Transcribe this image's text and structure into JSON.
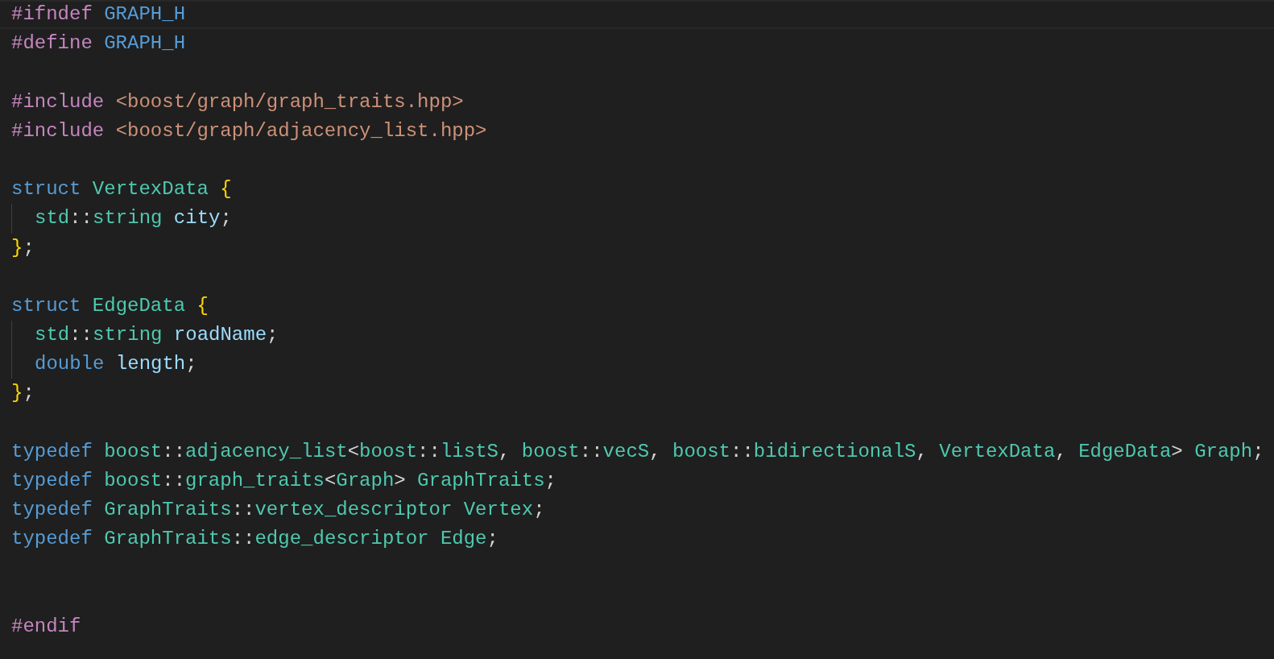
{
  "editor": {
    "lines": [
      {
        "kind": "code",
        "current": true,
        "tokens": [
          {
            "kind": "pp",
            "text": "#ifndef "
          },
          {
            "kind": "macro",
            "text": "GRAPH_H"
          }
        ]
      },
      {
        "kind": "code",
        "tokens": [
          {
            "kind": "pp",
            "text": "#define "
          },
          {
            "kind": "macro",
            "text": "GRAPH_H"
          }
        ]
      },
      {
        "kind": "blank"
      },
      {
        "kind": "code",
        "tokens": [
          {
            "kind": "pp",
            "text": "#include "
          },
          {
            "kind": "str",
            "text": "<boost/graph/graph_traits.hpp>"
          }
        ]
      },
      {
        "kind": "code",
        "tokens": [
          {
            "kind": "pp",
            "text": "#include "
          },
          {
            "kind": "str",
            "text": "<boost/graph/adjacency_list.hpp>"
          }
        ]
      },
      {
        "kind": "blank"
      },
      {
        "kind": "code",
        "tokens": [
          {
            "kind": "kw",
            "text": "struct "
          },
          {
            "kind": "type",
            "text": "VertexData "
          },
          {
            "kind": "brace",
            "text": "{"
          }
        ]
      },
      {
        "kind": "code",
        "indent_guide": true,
        "tokens": [
          {
            "kind": "type",
            "text": "std"
          },
          {
            "kind": "punct",
            "text": "::"
          },
          {
            "kind": "type",
            "text": "string "
          },
          {
            "kind": "var",
            "text": "city"
          },
          {
            "kind": "punct",
            "text": ";"
          }
        ]
      },
      {
        "kind": "code",
        "tokens": [
          {
            "kind": "brace",
            "text": "}"
          },
          {
            "kind": "punct",
            "text": ";"
          }
        ]
      },
      {
        "kind": "blank"
      },
      {
        "kind": "code",
        "tokens": [
          {
            "kind": "kw",
            "text": "struct "
          },
          {
            "kind": "type",
            "text": "EdgeData "
          },
          {
            "kind": "brace",
            "text": "{"
          }
        ]
      },
      {
        "kind": "code",
        "indent_guide": true,
        "tokens": [
          {
            "kind": "type",
            "text": "std"
          },
          {
            "kind": "punct",
            "text": "::"
          },
          {
            "kind": "type",
            "text": "string "
          },
          {
            "kind": "var",
            "text": "roadName"
          },
          {
            "kind": "punct",
            "text": ";"
          }
        ]
      },
      {
        "kind": "code",
        "indent_guide": true,
        "tokens": [
          {
            "kind": "kw",
            "text": "double "
          },
          {
            "kind": "var",
            "text": "length"
          },
          {
            "kind": "punct",
            "text": ";"
          }
        ]
      },
      {
        "kind": "code",
        "tokens": [
          {
            "kind": "brace",
            "text": "}"
          },
          {
            "kind": "punct",
            "text": ";"
          }
        ]
      },
      {
        "kind": "blank"
      },
      {
        "kind": "code",
        "tokens": [
          {
            "kind": "kw",
            "text": "typedef "
          },
          {
            "kind": "type",
            "text": "boost"
          },
          {
            "kind": "punct",
            "text": "::"
          },
          {
            "kind": "type",
            "text": "adjacency_list"
          },
          {
            "kind": "punct",
            "text": "<"
          },
          {
            "kind": "type",
            "text": "boost"
          },
          {
            "kind": "punct",
            "text": "::"
          },
          {
            "kind": "type",
            "text": "listS"
          },
          {
            "kind": "punct",
            "text": ", "
          },
          {
            "kind": "type",
            "text": "boost"
          },
          {
            "kind": "punct",
            "text": "::"
          },
          {
            "kind": "type",
            "text": "vecS"
          },
          {
            "kind": "punct",
            "text": ", "
          },
          {
            "kind": "type",
            "text": "boost"
          },
          {
            "kind": "punct",
            "text": "::"
          },
          {
            "kind": "type",
            "text": "bidirectionalS"
          },
          {
            "kind": "punct",
            "text": ", "
          },
          {
            "kind": "type",
            "text": "VertexData"
          },
          {
            "kind": "punct",
            "text": ", "
          },
          {
            "kind": "type",
            "text": "EdgeData"
          },
          {
            "kind": "punct",
            "text": "> "
          },
          {
            "kind": "type",
            "text": "Graph"
          },
          {
            "kind": "punct",
            "text": ";"
          }
        ]
      },
      {
        "kind": "code",
        "tokens": [
          {
            "kind": "kw",
            "text": "typedef "
          },
          {
            "kind": "type",
            "text": "boost"
          },
          {
            "kind": "punct",
            "text": "::"
          },
          {
            "kind": "type",
            "text": "graph_traits"
          },
          {
            "kind": "punct",
            "text": "<"
          },
          {
            "kind": "type",
            "text": "Graph"
          },
          {
            "kind": "punct",
            "text": "> "
          },
          {
            "kind": "type",
            "text": "GraphTraits"
          },
          {
            "kind": "punct",
            "text": ";"
          }
        ]
      },
      {
        "kind": "code",
        "tokens": [
          {
            "kind": "kw",
            "text": "typedef "
          },
          {
            "kind": "type",
            "text": "GraphTraits"
          },
          {
            "kind": "punct",
            "text": "::"
          },
          {
            "kind": "type",
            "text": "vertex_descriptor "
          },
          {
            "kind": "type",
            "text": "Vertex"
          },
          {
            "kind": "punct",
            "text": ";"
          }
        ]
      },
      {
        "kind": "code",
        "tokens": [
          {
            "kind": "kw",
            "text": "typedef "
          },
          {
            "kind": "type",
            "text": "GraphTraits"
          },
          {
            "kind": "punct",
            "text": "::"
          },
          {
            "kind": "type",
            "text": "edge_descriptor "
          },
          {
            "kind": "type",
            "text": "Edge"
          },
          {
            "kind": "punct",
            "text": ";"
          }
        ]
      },
      {
        "kind": "blank"
      },
      {
        "kind": "blank"
      },
      {
        "kind": "code",
        "tokens": [
          {
            "kind": "pp",
            "text": "#endif"
          }
        ]
      }
    ]
  }
}
